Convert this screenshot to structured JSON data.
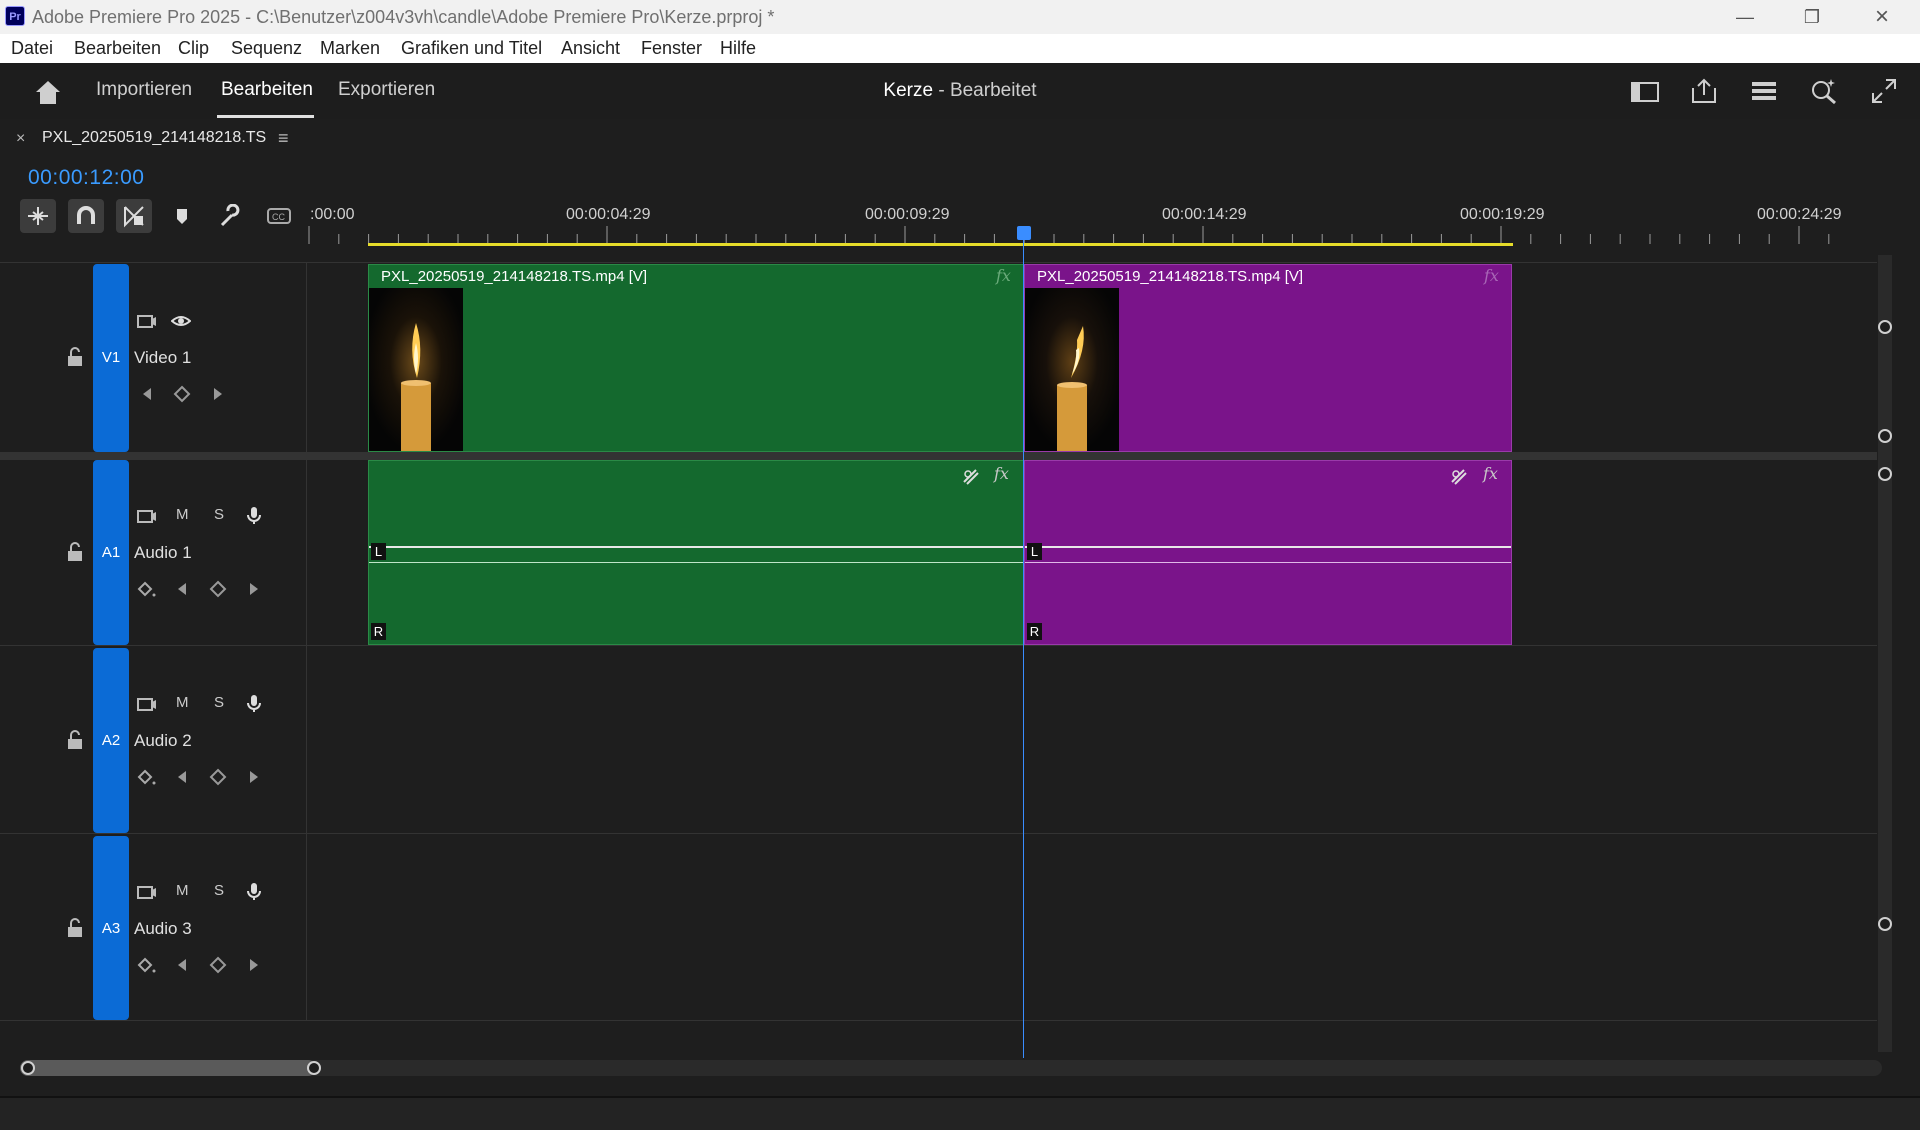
{
  "window": {
    "app_icon": "Pr",
    "title": "Adobe Premiere Pro 2025 - C:\\Benutzer\\z004v3vh\\candle\\Adobe Premiere Pro\\Kerze.prproj *",
    "controls": [
      "minimize-icon",
      "restore-icon",
      "close-icon"
    ]
  },
  "menu": [
    "Datei",
    "Bearbeiten",
    "Clip",
    "Sequenz",
    "Marken",
    "Grafiken und Titel",
    "Ansicht",
    "Fenster",
    "Hilfe"
  ],
  "workspace": {
    "tabs": [
      "Importieren",
      "Bearbeiten",
      "Exportieren"
    ],
    "active_tab": "Bearbeiten",
    "project_name": "Kerze",
    "project_status": " - Bearbeitet",
    "icons": [
      "home-icon",
      "panel-layout-icon",
      "share-icon",
      "workspaces-icon",
      "search-icon",
      "fullscreen-icon"
    ]
  },
  "timeline": {
    "panel_tab": "PXL_20250519_214148218.TS",
    "timecode": "00:00:12:00",
    "tools": [
      "insert-icon",
      "snap-magnet-icon",
      "linked-selection-icon",
      "add-marker-icon",
      "wrench-icon",
      "captions-icon"
    ],
    "ruler_labels": [
      ":00:00",
      "00:00:04:29",
      "00:00:09:29",
      "00:00:14:29",
      "00:00:19:29",
      "00:00:24:29"
    ],
    "tracks": [
      {
        "id": "V1",
        "name": "Video 1"
      },
      {
        "id": "A1",
        "name": "Audio 1",
        "m": "M",
        "s": "S"
      },
      {
        "id": "A2",
        "name": "Audio 2",
        "m": "M",
        "s": "S"
      },
      {
        "id": "A3",
        "name": "Audio 3",
        "m": "M",
        "s": "S"
      }
    ],
    "clips": [
      {
        "name": "PXL_20250519_214148218.TS.mp4 [V]",
        "fx": "fx",
        "color": "#14692e"
      },
      {
        "name": "PXL_20250519_214148218.TS.mp4 [V]",
        "fx": "fx",
        "color": "#7a148a"
      }
    ],
    "audio_clips": [
      {
        "fx": "fx",
        "left": "L",
        "right": "R",
        "color": "#14692e"
      },
      {
        "fx": "fx",
        "left": "L",
        "right": "R",
        "color": "#7a148a"
      }
    ]
  }
}
